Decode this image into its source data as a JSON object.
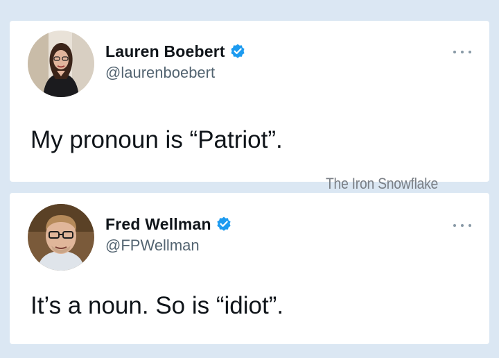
{
  "tweets": [
    {
      "avatar_icon": "profile-photo-woman",
      "display_name": "Lauren Boebert",
      "verified_icon": "verified-badge-icon",
      "handle": "@laurenboebert",
      "more_icon": "more-options-icon",
      "text": "My pronoun is “Patriot”."
    },
    {
      "avatar_icon": "profile-photo-man",
      "display_name": "Fred Wellman",
      "verified_icon": "verified-badge-icon",
      "handle": "@FPWellman",
      "more_icon": "more-options-icon",
      "text": "It’s a noun. So is “idiot”."
    }
  ],
  "watermark": "The Iron Snowflake",
  "colors": {
    "background": "#dbe7f3",
    "card": "#ffffff",
    "text": "#0f1419",
    "handle": "#536471",
    "verified": "#1d9bf0"
  }
}
